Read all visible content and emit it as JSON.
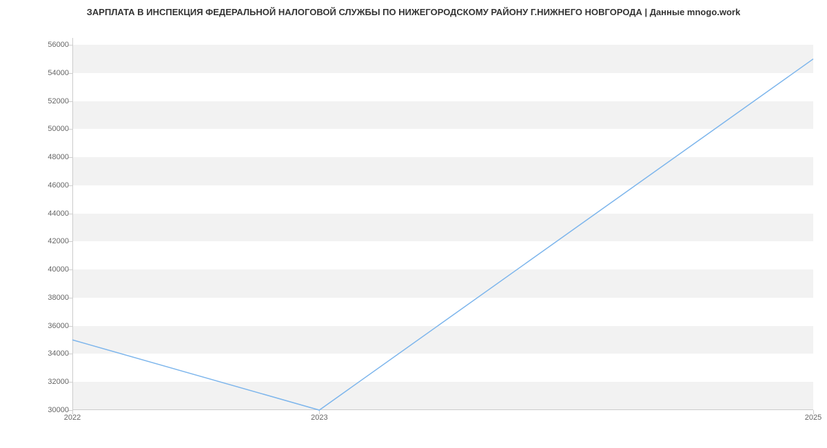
{
  "chart_data": {
    "type": "line",
    "title": "ЗАРПЛАТА В ИНСПЕКЦИЯ ФЕДЕРАЛЬНОЙ НАЛОГОВОЙ СЛУЖБЫ ПО НИЖЕГОРОДСКОМУ РАЙОНУ Г.НИЖНЕГО НОВГОРОДА | Данные mnogo.work",
    "x": [
      2022,
      2023,
      2025
    ],
    "values": [
      35000,
      30000,
      55000
    ],
    "x_ticks": [
      2022,
      2023,
      2025
    ],
    "y_ticks": [
      30000,
      32000,
      34000,
      36000,
      38000,
      40000,
      42000,
      44000,
      46000,
      48000,
      50000,
      52000,
      54000,
      56000
    ],
    "xlim": [
      2022,
      2025
    ],
    "ylim": [
      30000,
      56500
    ],
    "line_color": "#7cb5ec"
  }
}
